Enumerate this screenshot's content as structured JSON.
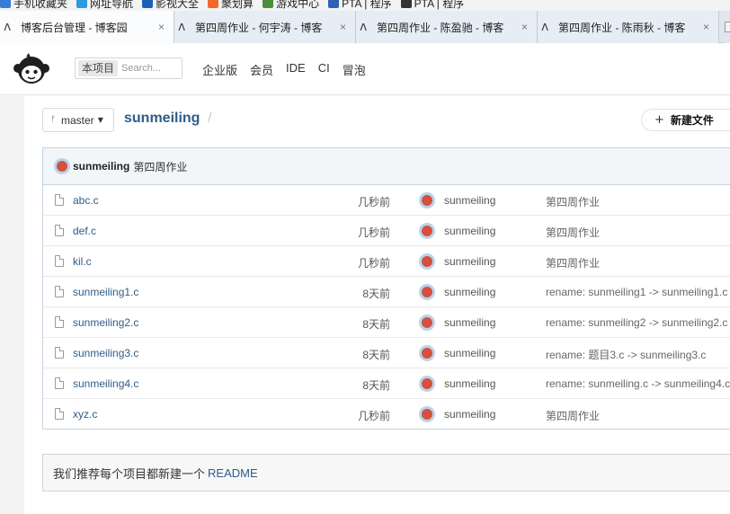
{
  "bookmarks": [
    {
      "label": "手机收藏夹",
      "color": "#3a7bd5"
    },
    {
      "label": "网址导航",
      "color": "#2a9be0"
    },
    {
      "label": "影视大全",
      "color": "#1b5fb8"
    },
    {
      "label": "聚划算",
      "color": "#f06a2a"
    },
    {
      "label": "游戏中心",
      "color": "#4a8f3a"
    },
    {
      "label": "PTA | 程序",
      "color": "#2f62b7"
    },
    {
      "label": "PTA | 程序",
      "color": "#333333"
    }
  ],
  "tabs": [
    {
      "label": "博客后台管理 - 博客园",
      "close": "×"
    },
    {
      "label": "第四周作业 - 何宇涛 - 博客",
      "close": "×"
    },
    {
      "label": "第四周作业 - 陈盈驰 - 博客",
      "close": "×"
    },
    {
      "label": "第四周作业 - 陈雨秋 - 博客",
      "close": "×"
    }
  ],
  "header": {
    "scope": "本项目",
    "search_placeholder": "Search...",
    "nav": [
      "企业版",
      "会员",
      "IDE",
      "CI",
      "冒泡"
    ]
  },
  "toolbar": {
    "branch": "master",
    "repo": "sunmeiling",
    "new_file": "新建文件"
  },
  "latest_commit": {
    "author": "sunmeiling",
    "message": "第四周作业"
  },
  "files": [
    {
      "name": "abc.c",
      "time": "几秒前",
      "author": "sunmeiling",
      "commit": "第四周作业"
    },
    {
      "name": "def.c",
      "time": "几秒前",
      "author": "sunmeiling",
      "commit": "第四周作业"
    },
    {
      "name": "kil.c",
      "time": "几秒前",
      "author": "sunmeiling",
      "commit": "第四周作业"
    },
    {
      "name": "sunmeiling1.c",
      "time": "8天前",
      "author": "sunmeiling",
      "commit": "rename: sunmeiling1 -> sunmeiling1.c"
    },
    {
      "name": "sunmeiling2.c",
      "time": "8天前",
      "author": "sunmeiling",
      "commit": "rename: sunmeiling2 -> sunmeiling2.c"
    },
    {
      "name": "sunmeiling3.c",
      "time": "8天前",
      "author": "sunmeiling",
      "commit": "rename: 题目3.c -> sunmeiling3.c"
    },
    {
      "name": "sunmeiling4.c",
      "time": "8天前",
      "author": "sunmeiling",
      "commit": "rename: sunmeiling.c -> sunmeiling4.c"
    },
    {
      "name": "xyz.c",
      "time": "几秒前",
      "author": "sunmeiling",
      "commit": "第四周作业"
    }
  ],
  "readme": {
    "text": "我们推荐每个项目都新建一个",
    "link": "README"
  }
}
